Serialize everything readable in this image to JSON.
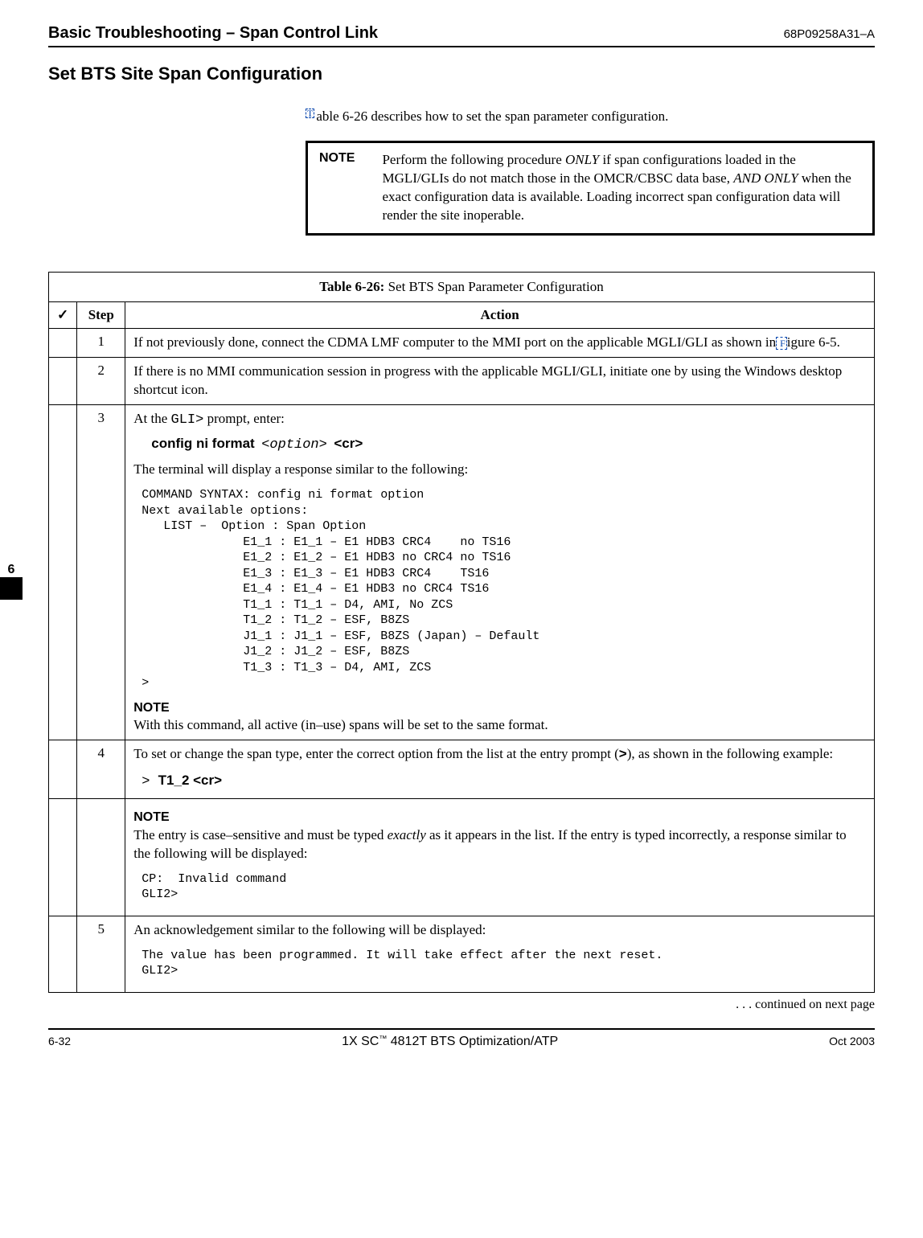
{
  "header": {
    "title": "Basic Troubleshooting – Span Control Link",
    "docnum": "68P09258A31–A"
  },
  "section_title": "Set BTS Site Span Configuration",
  "intro": {
    "ref": "T",
    "text": "able 6-26 describes how to set the span parameter configuration."
  },
  "note_box": {
    "label": "NOTE",
    "line1_a": "Perform the following procedure ",
    "line1_b": "ONLY",
    "line1_c": " if span configurations loaded in the MGLI/GLIs do not match those in the OMCR/CBSC data base, ",
    "line1_d": "AND ONLY",
    "line1_e": " when the exact configuration data is available. Loading incorrect span configuration data will render the site inoperable."
  },
  "table": {
    "caption_bold": "Table 6-26:",
    "caption_rest": " Set BTS Span Parameter Configuration",
    "headers": {
      "check": "✓",
      "step": "Step",
      "action": "Action"
    },
    "rows": {
      "r1": {
        "step": "1",
        "text_a": "If not previously done, connect the CDMA LMF computer to the MMI port on the applicable MGLI/GLI as shown in",
        "link": " F",
        "text_b": "igure 6-5."
      },
      "r2": {
        "step": "2",
        "text": "If there is no MMI communication session in progress with the applicable MGLI/GLI, initiate one by using the Windows desktop shortcut icon."
      },
      "r3": {
        "step": "3",
        "at_the": "At the ",
        "prompt": "GLI>",
        "prompt_tail": " prompt, enter:",
        "cmd": "config  ni  format",
        "opt": "<option>",
        "cr": "<cr>",
        "resp_intro": "The terminal will display a response similar to the following:",
        "terminal": "COMMAND SYNTAX: config ni format option\nNext available options:\n   LIST –  Option : Span Option\n              E1_1 : E1_1 – E1 HDB3 CRC4    no TS16\n              E1_2 : E1_2 – E1 HDB3 no CRC4 no TS16\n              E1_3 : E1_3 – E1 HDB3 CRC4    TS16\n              E1_4 : E1_4 – E1 HDB3 no CRC4 TS16\n              T1_1 : T1_1 – D4, AMI, No ZCS\n              T1_2 : T1_2 – ESF, B8ZS\n              J1_1 : J1_1 – ESF, B8ZS (Japan) – Default\n              J1_2 : J1_2 – ESF, B8ZS\n              T1_3 : T1_3 – D4, AMI, ZCS\n>",
        "note_head": "NOTE",
        "note_text": "With this command, all active (in–use) spans will be set to the same format."
      },
      "r4": {
        "step": "4",
        "text_a": "To set or change the span type, enter the correct option from the list at the entry prompt (",
        "gt": ">",
        "text_b": "), as shown in the following example:",
        "example_prompt": "> ",
        "example_cmd": "T1_2 <cr>"
      },
      "r5": {
        "note_head": "NOTE",
        "text_a": "The entry is case–sensitive and must be typed ",
        "exactly": "exactly",
        "text_b": " as it appears in the list. If the entry is typed incorrectly, a response similar to the following will be displayed:",
        "terminal": "CP:  Invalid command\nGLI2>"
      },
      "r6": {
        "step": "5",
        "text": "An acknowledgement similar to the following will be displayed:",
        "terminal": "The value has been programmed. It will take effect after the next reset.\nGLI2>"
      }
    }
  },
  "continued": ". . . continued on next page",
  "side_tab": {
    "chapter": "6"
  },
  "footer": {
    "left": "6-32",
    "center_a": "1X SC",
    "center_tm": "™",
    "center_b": " 4812T BTS Optimization/ATP",
    "right": "Oct 2003"
  }
}
